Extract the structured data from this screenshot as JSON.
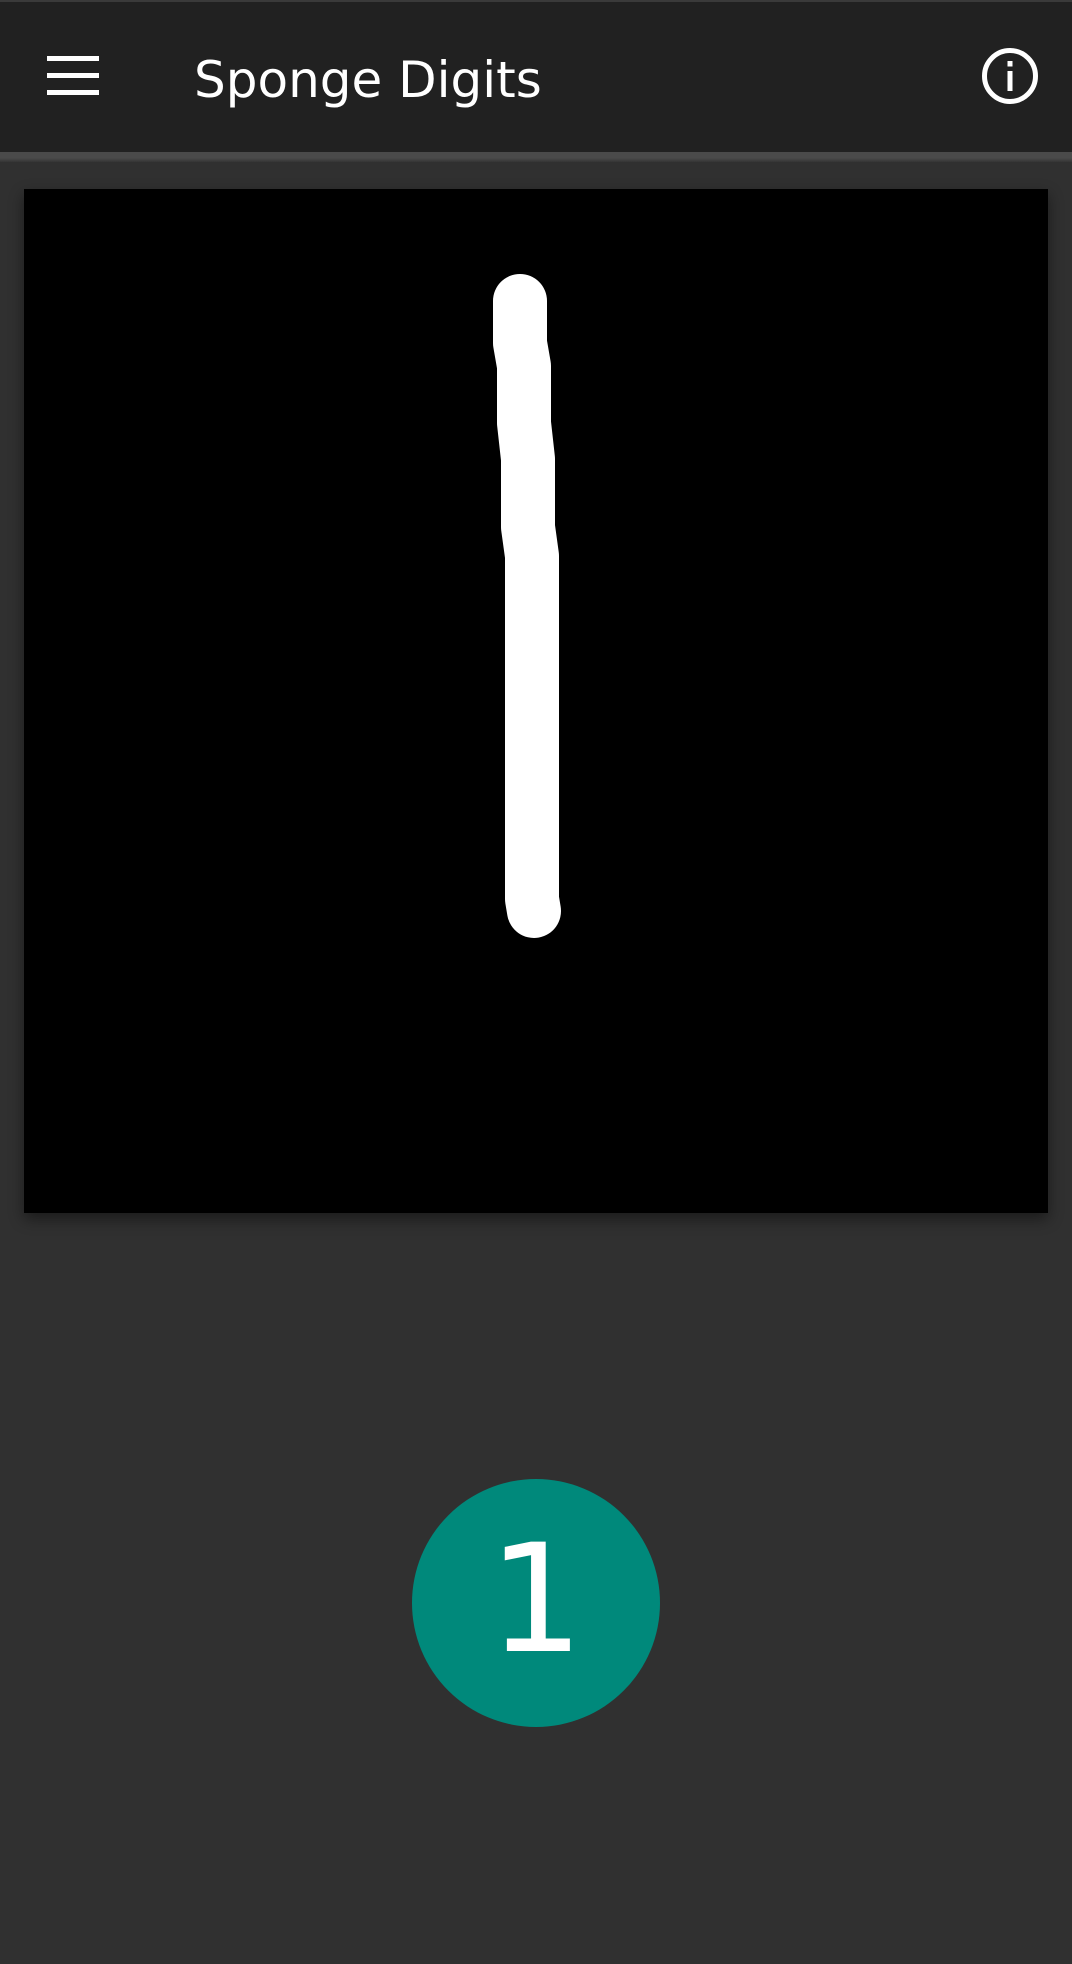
{
  "toolbar": {
    "title": "Sponge Digits",
    "menu_icon": "menu-icon",
    "info_icon": "info-icon",
    "background_color": "#212121",
    "text_color": "#ffffff"
  },
  "drawing_canvas": {
    "background_color": "#000000",
    "stroke_color": "#ffffff"
  },
  "prediction": {
    "digit": "1",
    "badge_color": "#00897b"
  },
  "page": {
    "background_color": "#303030"
  }
}
